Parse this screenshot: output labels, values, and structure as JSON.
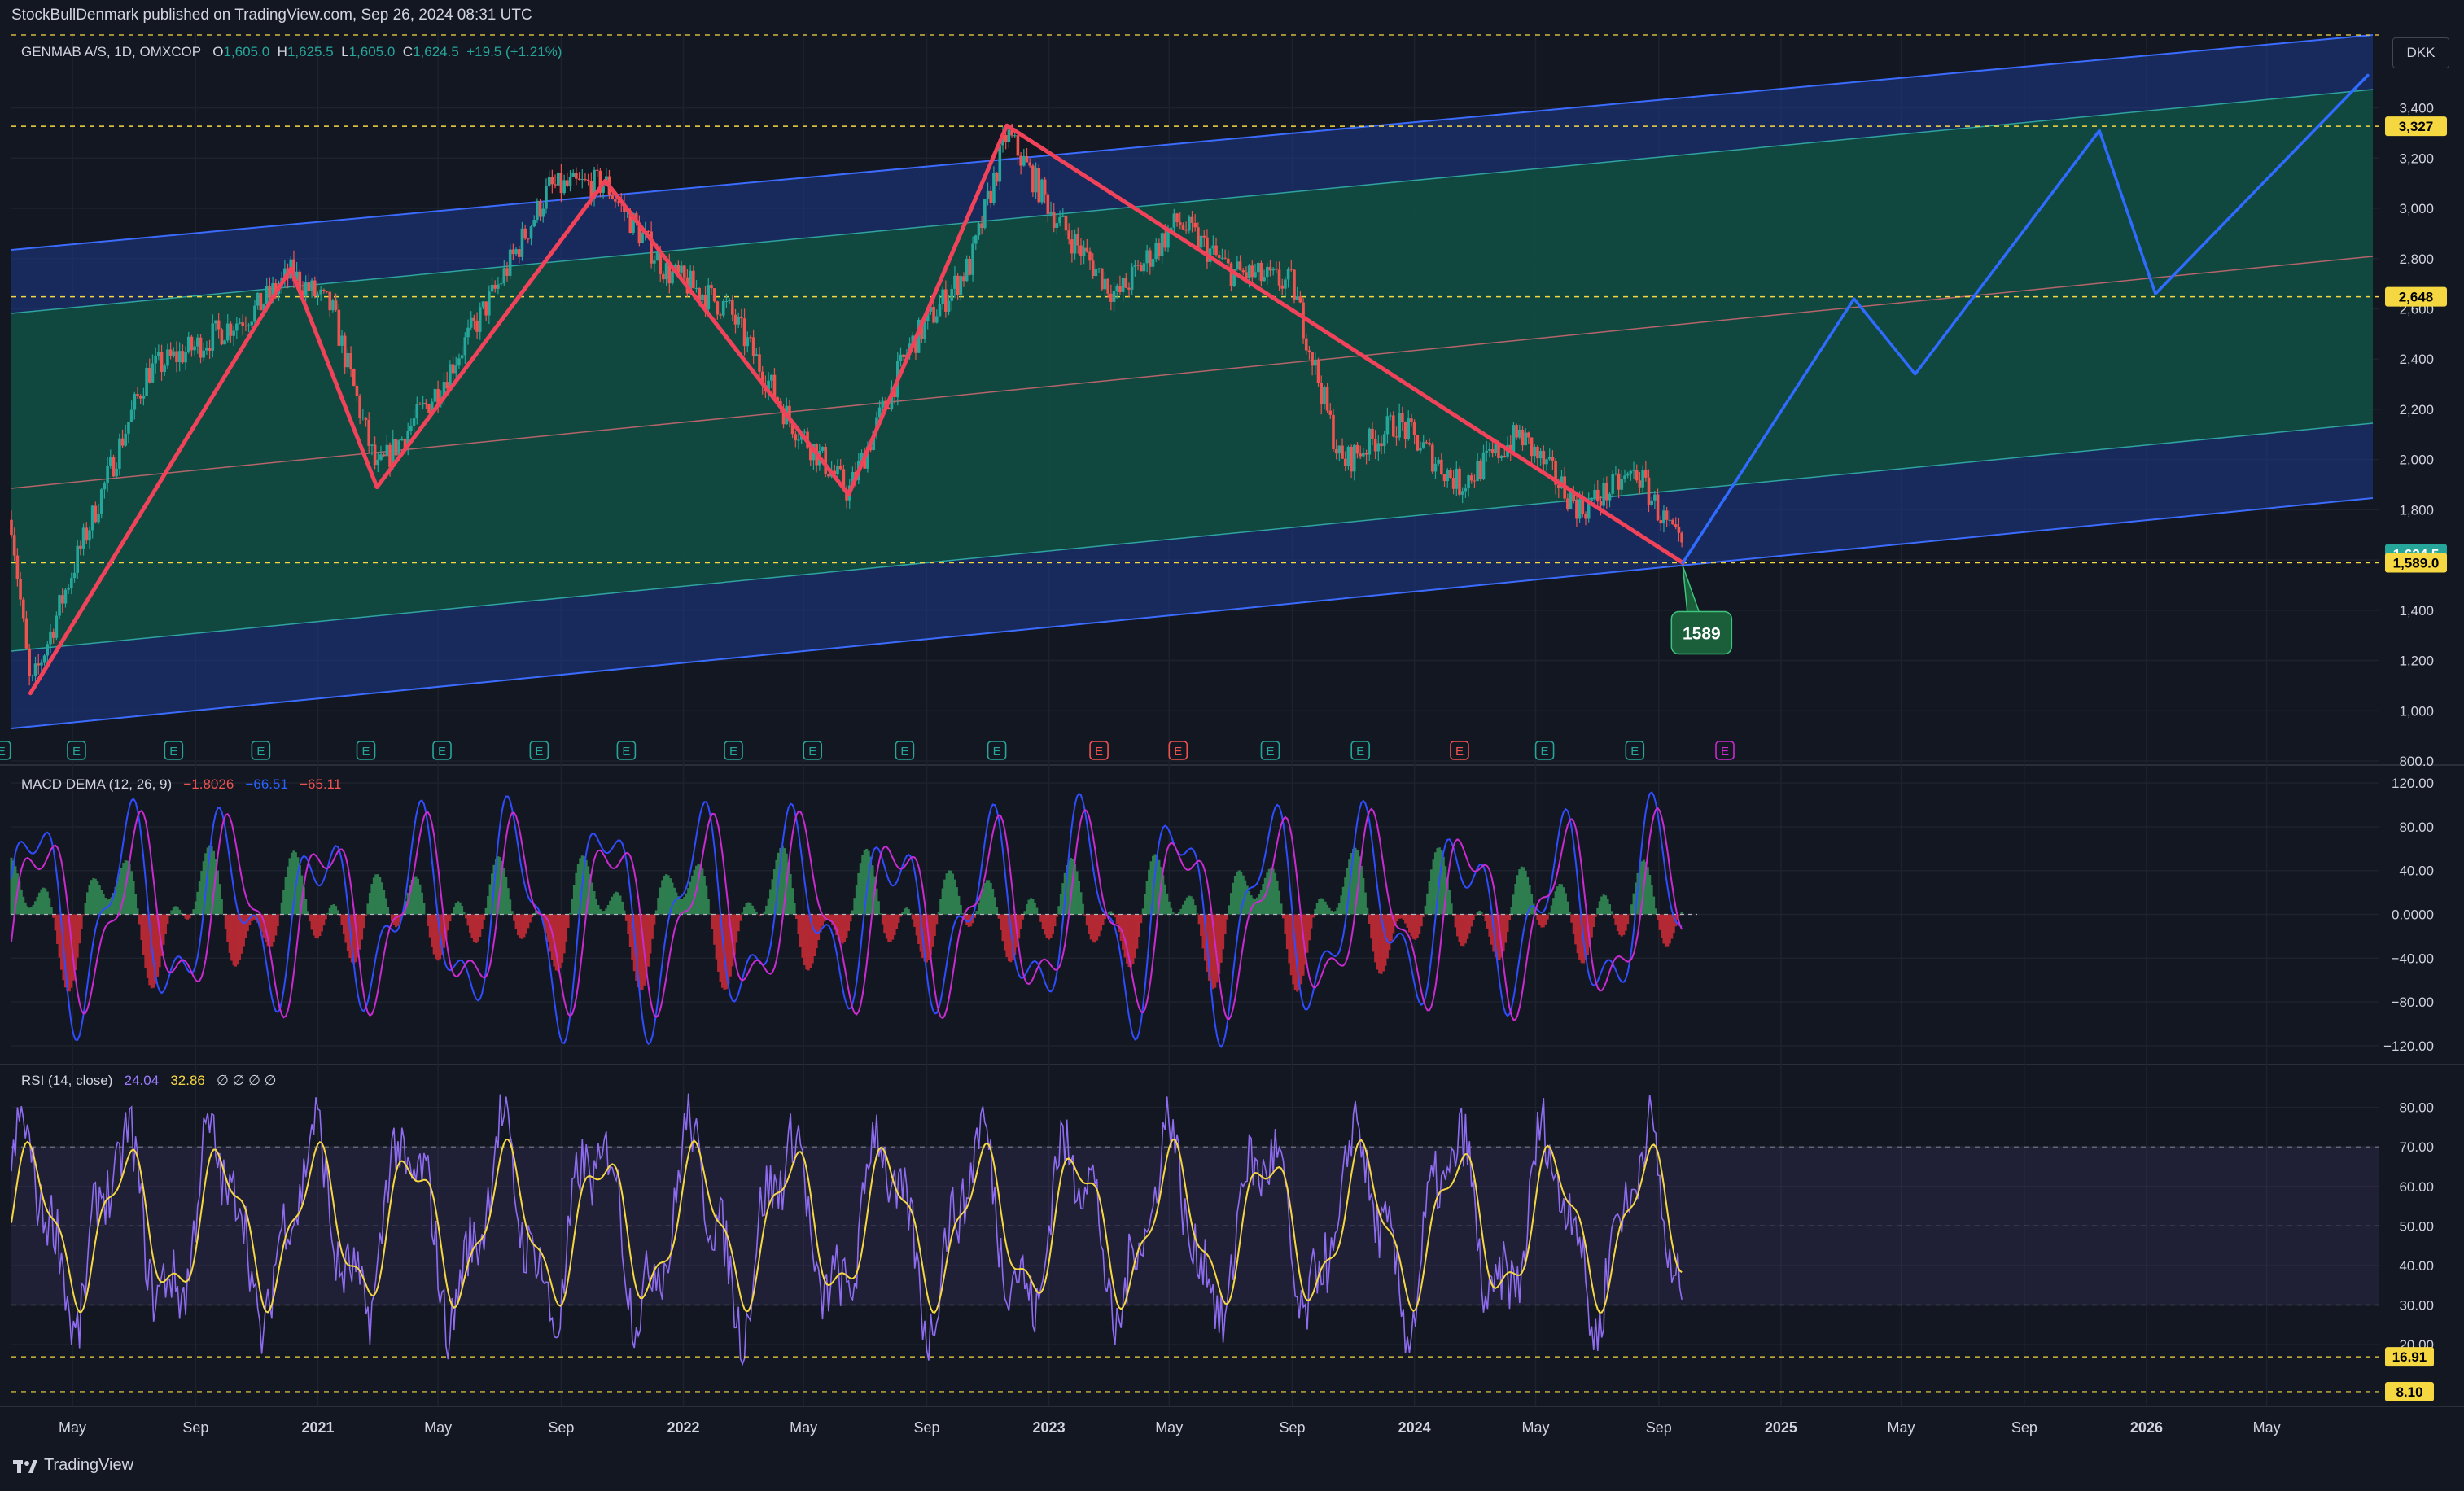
{
  "header": {
    "published": "StockBullDenmark published on TradingView.com, Sep 26, 2024 08:31 UTC",
    "brand": "TradingView",
    "currency": "DKK"
  },
  "colors": {
    "bg": "#131722",
    "grid": "#1e222d",
    "text": "#d1d4dc",
    "channel_outer": "#1e3a8a",
    "channel_inner": "#0f4d3c",
    "zigzag": "#f0435a",
    "projection": "#2f6bff",
    "candle_up": "#26a69a",
    "candle_down": "#ef5350",
    "macd": "#2f4cff",
    "signal": "#c92bd1",
    "rsi": "#8e6cf0",
    "rsi_ma": "#f5d742"
  },
  "price_pane": {
    "symbol": "GENMAB A/S, 1D, OMXCOP",
    "o_label": "O",
    "o_value": "1,605.0",
    "h_label": "H",
    "h_value": "1,625.5",
    "l_label": "L",
    "l_value": "1,605.0",
    "c_label": "C",
    "c_value": "1,624.5",
    "change": "+19.5 (+1.21%)",
    "callout": "1589",
    "earnings_glyph": "E"
  },
  "macd_pane": {
    "name": "MACD DEMA (12, 26, 9)",
    "v1": "−1.8026",
    "v2": "−66.51",
    "v3": "−65.11"
  },
  "rsi_pane": {
    "name": "RSI (14, close)",
    "v1": "24.04",
    "v2": "32.86",
    "na": "∅ ∅ ∅ ∅"
  },
  "chart_data": [
    {
      "type": "line",
      "pane": "price",
      "x_ticks": [
        "May",
        "Sep",
        "2021",
        "May",
        "Sep",
        "2022",
        "May",
        "Sep",
        "2023",
        "May",
        "Sep",
        "2024",
        "May",
        "Sep",
        "2025",
        "May",
        "Sep",
        "2026",
        "May"
      ],
      "x_range": [
        "2020-03-01",
        "2026-08-15"
      ],
      "ylim": [
        800,
        3700
      ],
      "y_ticks": [
        "3,400",
        "3,200",
        "3,000",
        "2,800",
        "2,600",
        "2,400",
        "2,200",
        "2,000",
        "1,800",
        "1,600",
        "1,400",
        "1,200",
        "1,000",
        "800.0"
      ],
      "y_tick_values": [
        3400,
        3200,
        3000,
        2800,
        2600,
        2400,
        2200,
        2000,
        1800,
        1600,
        1400,
        1200,
        1000,
        800
      ],
      "price_labels": [
        {
          "text": "3,327",
          "value": 3327,
          "color": "#f5d742",
          "text_color": "#000000",
          "dashed": true
        },
        {
          "text": "2,648",
          "value": 2648,
          "color": "#f5d742",
          "text_color": "#000000",
          "dashed": true
        },
        {
          "text": "1,624.5",
          "value": 1624.5,
          "color": "#26a69a",
          "text_color": "#ffffff",
          "dashed": false
        },
        {
          "text": "1,589.0",
          "value": 1589,
          "color": "#f5d742",
          "text_color": "#000000",
          "dashed": true
        }
      ],
      "series": [
        {
          "role": "zigzag",
          "x": [
            "2020-03-20",
            "2020-12-05",
            "2021-03-01",
            "2021-10-15",
            "2022-06-15",
            "2022-11-20",
            "2024-09-25"
          ],
          "y": [
            1070,
            2760,
            1890,
            3110,
            1860,
            3330,
            1589
          ]
        },
        {
          "role": "projection",
          "x": [
            "2024-09-25",
            "2025-03-15",
            "2025-05-15",
            "2025-11-15",
            "2026-01-10",
            "2026-08-10"
          ],
          "y": [
            1589,
            2640,
            2340,
            3310,
            2660,
            3530
          ]
        },
        {
          "role": "close",
          "x": [
            "2020-03-01",
            "2020-03-20",
            "2020-05-01",
            "2020-07-15",
            "2020-09-01",
            "2020-11-01",
            "2020-12-05",
            "2021-01-15",
            "2021-03-01",
            "2021-05-01",
            "2021-07-01",
            "2021-08-20",
            "2021-10-15",
            "2021-12-15",
            "2022-02-15",
            "2022-04-15",
            "2022-06-15",
            "2022-08-15",
            "2022-10-15",
            "2022-11-20",
            "2023-01-10",
            "2023-03-10",
            "2023-05-10",
            "2023-07-01",
            "2023-09-01",
            "2023-10-20",
            "2023-12-15",
            "2024-02-15",
            "2024-04-15",
            "2024-06-15",
            "2024-08-10",
            "2024-09-25"
          ],
          "y": [
            1760,
            1080,
            1560,
            2350,
            2450,
            2600,
            2740,
            2600,
            1950,
            2280,
            2700,
            3080,
            3100,
            2750,
            2600,
            2170,
            1870,
            2450,
            2780,
            3300,
            2950,
            2650,
            2950,
            2750,
            2700,
            1980,
            2150,
            1900,
            2100,
            1800,
            1950,
            1624.5
          ]
        }
      ],
      "earnings_markers": [
        {
          "x": "2020-02-20",
          "sign": "pos"
        },
        {
          "x": "2020-05-05",
          "sign": "pos"
        },
        {
          "x": "2020-08-10",
          "sign": "pos"
        },
        {
          "x": "2020-11-05",
          "sign": "pos"
        },
        {
          "x": "2021-02-18",
          "sign": "pos"
        },
        {
          "x": "2021-05-05",
          "sign": "pos"
        },
        {
          "x": "2021-08-10",
          "sign": "pos"
        },
        {
          "x": "2021-11-05",
          "sign": "pos"
        },
        {
          "x": "2022-02-20",
          "sign": "pos"
        },
        {
          "x": "2022-05-10",
          "sign": "pos"
        },
        {
          "x": "2022-08-10",
          "sign": "pos"
        },
        {
          "x": "2022-11-10",
          "sign": "pos"
        },
        {
          "x": "2023-02-20",
          "sign": "neg"
        },
        {
          "x": "2023-05-10",
          "sign": "neg"
        },
        {
          "x": "2023-08-10",
          "sign": "pos"
        },
        {
          "x": "2023-11-08",
          "sign": "pos"
        },
        {
          "x": "2024-02-15",
          "sign": "neg"
        },
        {
          "x": "2024-05-10",
          "sign": "pos"
        },
        {
          "x": "2024-08-08",
          "sign": "pos"
        },
        {
          "x": "2024-11-06",
          "sign": "future"
        }
      ]
    },
    {
      "type": "line",
      "pane": "macd",
      "ylim": [
        -135,
        135
      ],
      "y_ticks": [
        "120.00",
        "80.00",
        "40.00",
        "0.0000",
        "−40.00",
        "−80.00",
        "−120.00"
      ],
      "y_tick_values": [
        120,
        80,
        40,
        0,
        -40,
        -80,
        -120
      ],
      "series": [
        {
          "name": "MACD",
          "period_days": 95,
          "amplitude": 75
        },
        {
          "name": "Signal",
          "period_days": 95,
          "amplitude": 70
        }
      ]
    },
    {
      "type": "line",
      "pane": "rsi",
      "ylim": [
        5,
        90
      ],
      "y_ticks": [
        "80.00",
        "70.00",
        "60.00",
        "50.00",
        "40.00",
        "30.00",
        "20.00"
      ],
      "y_tick_values": [
        80,
        70,
        60,
        50,
        40,
        30,
        20
      ],
      "band": [
        30,
        70
      ],
      "price_labels": [
        {
          "text": "16.91",
          "value": 16.91,
          "color": "#f5d742",
          "text_color": "#000000"
        },
        {
          "text": "8.10",
          "value": 8.1,
          "color": "#f5d742",
          "text_color": "#000000"
        }
      ],
      "series": [
        {
          "name": "RSI",
          "period_days": 95,
          "amplitude": 20
        },
        {
          "name": "RSI MA",
          "period_days": 95,
          "amplitude": 17
        }
      ]
    }
  ]
}
